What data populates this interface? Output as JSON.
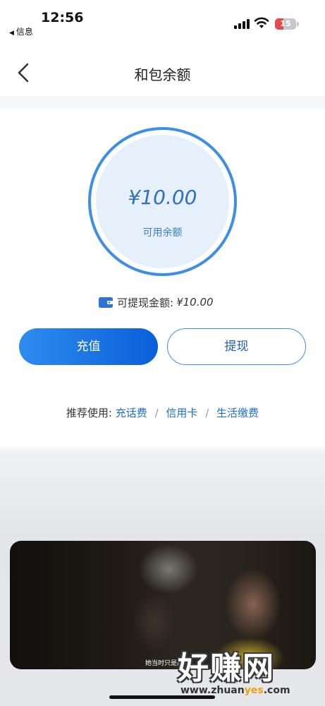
{
  "status_bar": {
    "time": "12:56",
    "back_app": "信息",
    "battery_level": "15"
  },
  "nav": {
    "title": "和包余额"
  },
  "balance": {
    "amount": "¥10.00",
    "label": "可用余额"
  },
  "withdrawable": {
    "label": "可提现金额:",
    "value": "¥10.00"
  },
  "actions": {
    "recharge": "充值",
    "withdraw": "提现"
  },
  "recommend": {
    "prefix": "推荐使用:",
    "links": [
      "充话费",
      "信用卡",
      "生活缴费"
    ],
    "separator": "/"
  },
  "video": {
    "subtitle": "她当时只是间"
  },
  "watermark": {
    "big": "好赚网",
    "small_prefix": "www.zhuan",
    "small_highlight": "yes",
    "small_suffix": ".com"
  },
  "colors": {
    "accent": "#3d8fe6",
    "button_gradient_start": "#2d8cf0",
    "button_gradient_end": "#0a5fd8",
    "battery_low": "#e04b4b"
  },
  "icons": [
    "back-chevron-icon",
    "wallet-icon",
    "signal-icon",
    "wifi-icon",
    "battery-icon"
  ]
}
